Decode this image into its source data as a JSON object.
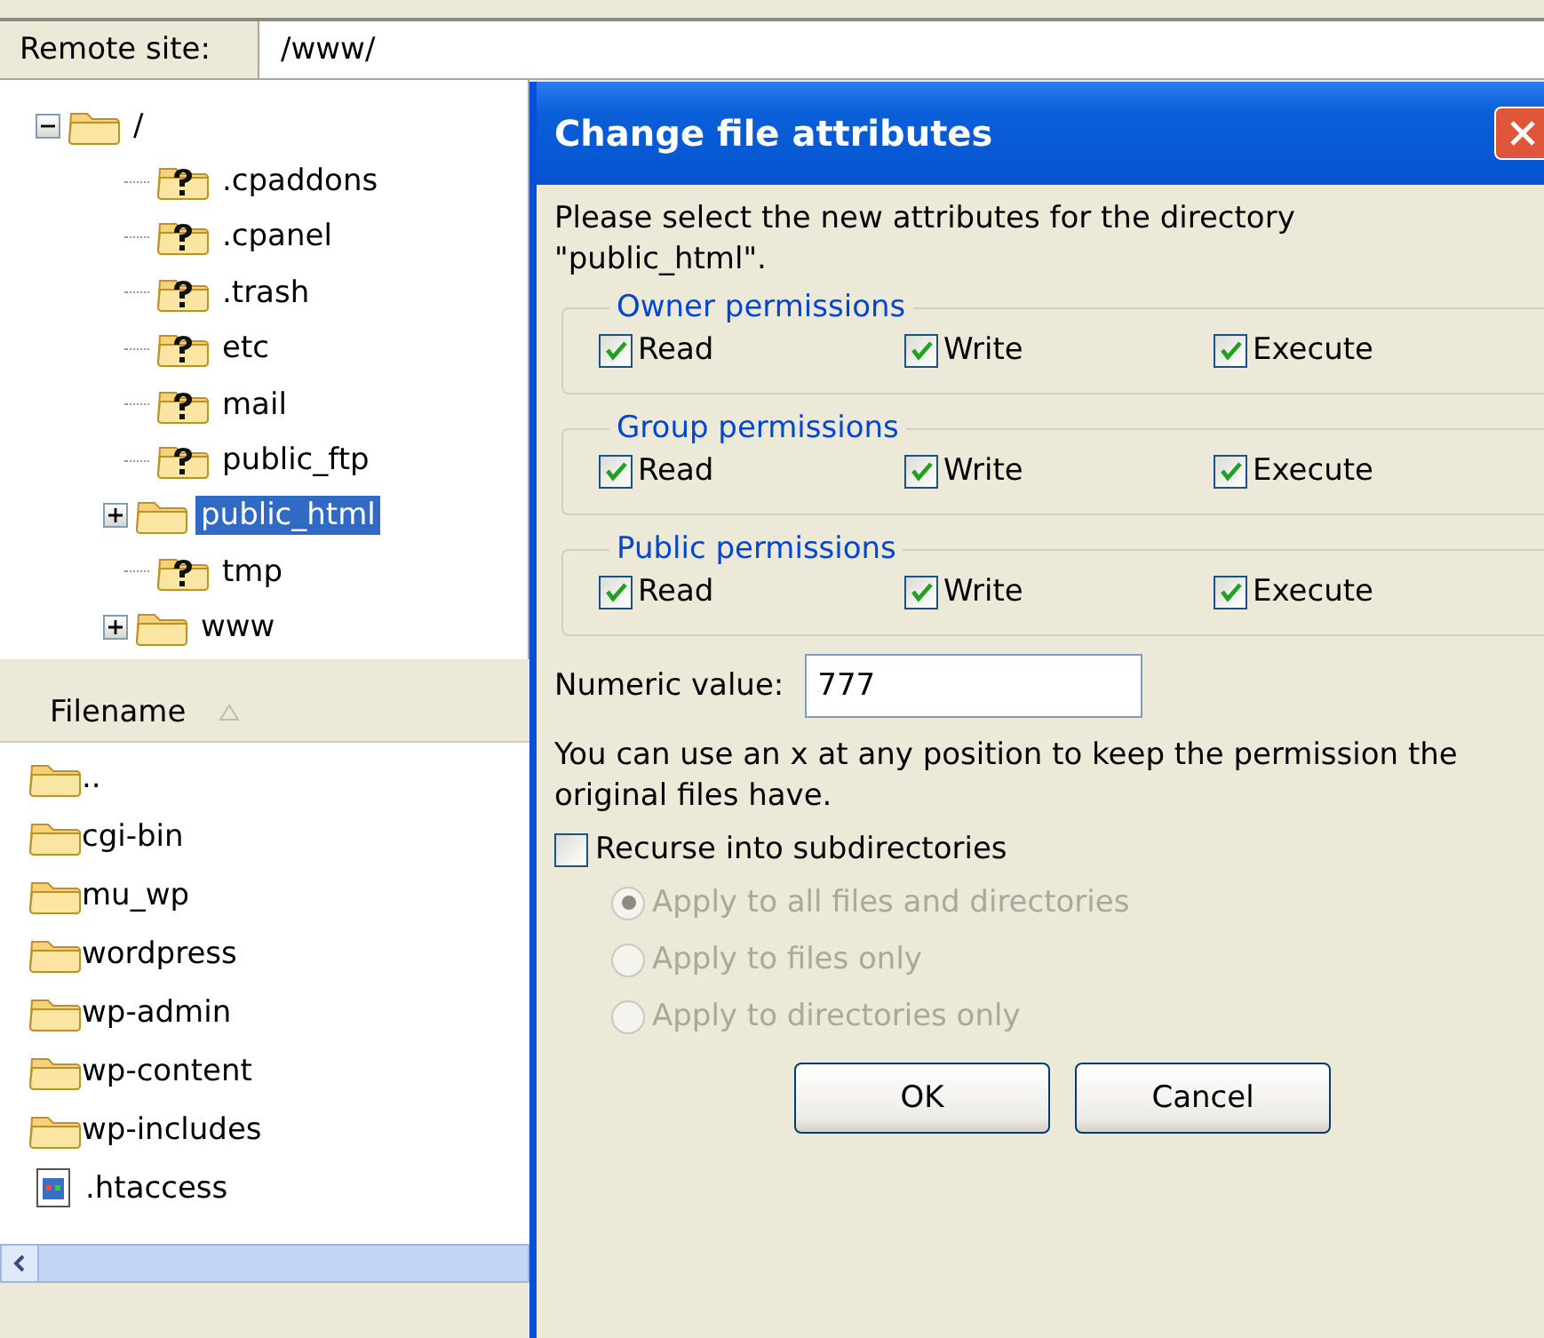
{
  "remote_site": {
    "label": "Remote site:",
    "path": "/www/"
  },
  "tree": {
    "name": "/",
    "expanded": true,
    "selected": false,
    "children": [
      {
        "name": ".cpaddons",
        "kind": "unknown",
        "selected": false
      },
      {
        "name": ".cpanel",
        "kind": "unknown",
        "selected": false
      },
      {
        "name": ".trash",
        "kind": "unknown",
        "selected": false
      },
      {
        "name": "etc",
        "kind": "unknown",
        "selected": false
      },
      {
        "name": "mail",
        "kind": "unknown",
        "selected": false
      },
      {
        "name": "public_ftp",
        "kind": "unknown",
        "selected": false
      },
      {
        "name": "public_html",
        "kind": "folder",
        "selected": true
      },
      {
        "name": "tmp",
        "kind": "unknown",
        "selected": false
      },
      {
        "name": "www",
        "kind": "folder",
        "selected": false
      }
    ]
  },
  "file_list": {
    "column": "Filename",
    "rows": [
      {
        "name": "..",
        "kind": "folder"
      },
      {
        "name": "cgi-bin",
        "kind": "folder"
      },
      {
        "name": "mu_wp",
        "kind": "folder"
      },
      {
        "name": "wordpress",
        "kind": "folder"
      },
      {
        "name": "wp-admin",
        "kind": "folder"
      },
      {
        "name": "wp-content",
        "kind": "folder"
      },
      {
        "name": "wp-includes",
        "kind": "folder"
      },
      {
        "name": ".htaccess",
        "kind": "file"
      }
    ]
  },
  "dialog": {
    "title": "Change file attributes",
    "prompt_lines": [
      "Please select the new attributes for the directory",
      "\"public_html\"."
    ],
    "groups": [
      {
        "title": "Owner permissions",
        "options": [
          {
            "label": "Read",
            "checked": true
          },
          {
            "label": "Write",
            "checked": true
          },
          {
            "label": "Execute",
            "checked": true
          }
        ]
      },
      {
        "title": "Group permissions",
        "options": [
          {
            "label": "Read",
            "checked": true
          },
          {
            "label": "Write",
            "checked": true
          },
          {
            "label": "Execute",
            "checked": true
          }
        ]
      },
      {
        "title": "Public permissions",
        "options": [
          {
            "label": "Read",
            "checked": true
          },
          {
            "label": "Write",
            "checked": true
          },
          {
            "label": "Execute",
            "checked": true
          }
        ]
      }
    ],
    "numeric_label": "Numeric value:",
    "numeric_value": "777",
    "hint_lines": [
      "You can use an x at any position to keep the permission the",
      "original files have."
    ],
    "recurse": {
      "label": "Recurse into subdirectories",
      "checked": false
    },
    "apply_options": [
      {
        "label": "Apply to all files and directories",
        "selected": true,
        "disabled": true
      },
      {
        "label": "Apply to files only",
        "selected": false,
        "disabled": true
      },
      {
        "label": "Apply to directories only",
        "selected": false,
        "disabled": true
      }
    ],
    "buttons": [
      "OK",
      "Cancel"
    ]
  }
}
